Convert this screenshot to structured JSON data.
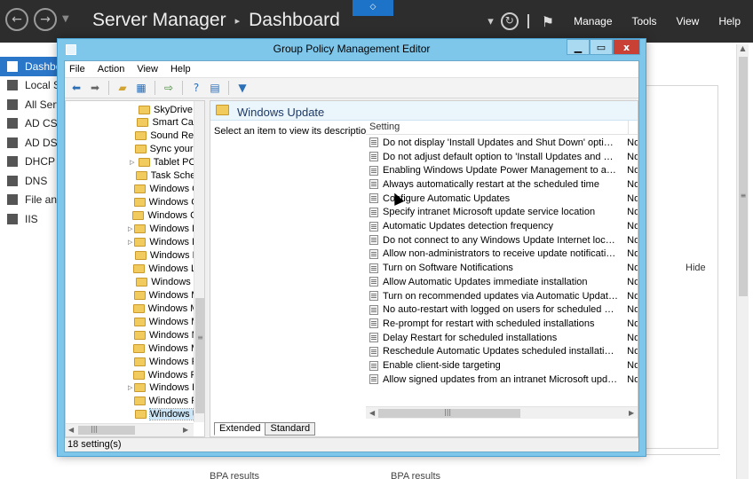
{
  "server_manager": {
    "title": "Server Manager",
    "breadcrumb_sep": "▸",
    "page": "Dashboard",
    "center_tab_icon": "chevron-down-icon",
    "menu": [
      "Manage",
      "Tools",
      "View",
      "Help"
    ],
    "sidebar": [
      {
        "label": "Dashboard",
        "icon": "dashboard-icon",
        "active": true
      },
      {
        "label": "Local Server",
        "icon": "server-icon"
      },
      {
        "label": "All Servers",
        "icon": "servers-icon"
      },
      {
        "label": "AD CS",
        "icon": "certificate-icon"
      },
      {
        "label": "AD DS",
        "icon": "directory-icon"
      },
      {
        "label": "DHCP",
        "icon": "dhcp-icon"
      },
      {
        "label": "DNS",
        "icon": "dns-icon"
      },
      {
        "label": "File and Storage Services",
        "icon": "file-storage-icon"
      },
      {
        "label": "IIS",
        "icon": "iis-icon"
      }
    ],
    "hide_label": "Hide",
    "bpa_results_1": "BPA results",
    "bpa_results_2": "BPA results"
  },
  "gpme": {
    "title": "Group Policy Management Editor",
    "menu": [
      "File",
      "Action",
      "View",
      "Help"
    ],
    "tree_items": [
      {
        "label": "SkyDrive",
        "expandable": false
      },
      {
        "label": "Smart Card",
        "expandable": false
      },
      {
        "label": "Sound Recorder",
        "expandable": false
      },
      {
        "label": "Sync your settings",
        "expandable": false
      },
      {
        "label": "Tablet PC",
        "expandable": true
      },
      {
        "label": "Task Scheduler",
        "expandable": false
      },
      {
        "label": "Windows Calendar",
        "expandable": false
      },
      {
        "label": "Windows Color System",
        "expandable": false
      },
      {
        "label": "Windows Customer Experience",
        "expandable": false
      },
      {
        "label": "Windows Defender",
        "expandable": true
      },
      {
        "label": "Windows Error Reporting",
        "expandable": true
      },
      {
        "label": "Windows Installer",
        "expandable": false
      },
      {
        "label": "Windows Logon Options",
        "expandable": false
      },
      {
        "label": "Windows Mail",
        "expandable": false
      },
      {
        "label": "Windows Media Center",
        "expandable": false
      },
      {
        "label": "Windows Media Digital Rights",
        "expandable": false
      },
      {
        "label": "Windows Media Player",
        "expandable": false
      },
      {
        "label": "Windows Messenger",
        "expandable": false
      },
      {
        "label": "Windows Mobility Center",
        "expandable": false
      },
      {
        "label": "Windows PowerShell",
        "expandable": false
      },
      {
        "label": "Windows Reliability Analysis",
        "expandable": false
      },
      {
        "label": "Windows Remote Management",
        "expandable": true
      },
      {
        "label": "Windows Remote Shell",
        "expandable": false
      },
      {
        "label": "Windows Update",
        "expandable": false,
        "selected": true
      }
    ],
    "right_header": "Windows Update",
    "description": "Select an item to view its description.",
    "column_setting": "Setting",
    "settings": [
      {
        "name": "Do not display 'Install Updates and Shut Down' option in Shut Down Windows dialog box",
        "state": "Not configured"
      },
      {
        "name": "Do not adjust default option to 'Install Updates and Shut Down' in Shut Down Windows dialog box",
        "state": "Not configured"
      },
      {
        "name": "Enabling Windows Update Power Management to automatically wake up the system",
        "state": "Not configured"
      },
      {
        "name": "Always automatically restart at the scheduled time",
        "state": "Not configured"
      },
      {
        "name": "Configure Automatic Updates",
        "state": "Not configured"
      },
      {
        "name": "Specify intranet Microsoft update service location",
        "state": "Not configured"
      },
      {
        "name": "Automatic Updates detection frequency",
        "state": "Not configured"
      },
      {
        "name": "Do not connect to any Windows Update Internet locations",
        "state": "Not configured"
      },
      {
        "name": "Allow non-administrators to receive update notifications",
        "state": "Not configured"
      },
      {
        "name": "Turn on Software Notifications",
        "state": "Not configured"
      },
      {
        "name": "Allow Automatic Updates immediate installation",
        "state": "Not configured"
      },
      {
        "name": "Turn on recommended updates via Automatic Updates",
        "state": "Not configured"
      },
      {
        "name": "No auto-restart with logged on users for scheduled automatic updates installations",
        "state": "Not configured"
      },
      {
        "name": "Re-prompt for restart with scheduled installations",
        "state": "Not configured"
      },
      {
        "name": "Delay Restart for scheduled installations",
        "state": "Not configured"
      },
      {
        "name": "Reschedule Automatic Updates scheduled installations",
        "state": "Not configured"
      },
      {
        "name": "Enable client-side targeting",
        "state": "Not configured"
      },
      {
        "name": "Allow signed updates from an intranet Microsoft update service location",
        "state": "Not configured"
      }
    ],
    "tabs": [
      "Extended",
      "Standard"
    ],
    "status": "18 setting(s)"
  }
}
